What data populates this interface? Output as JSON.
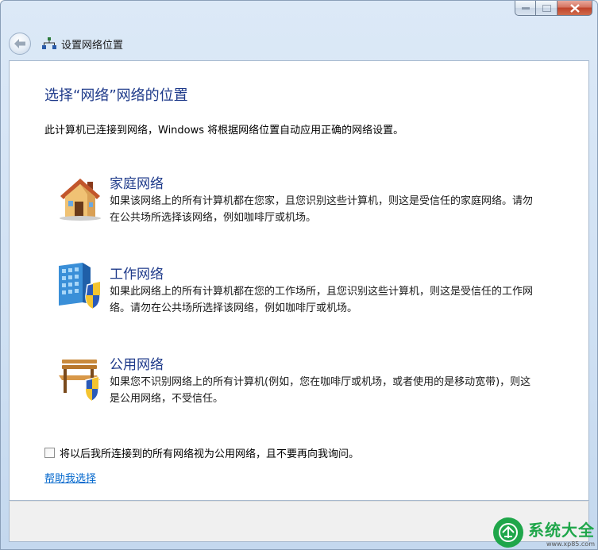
{
  "window": {
    "title": "设置网络位置"
  },
  "page": {
    "heading": "选择“网络”网络的位置",
    "intro": "此计算机已连接到网络，Windows 将根据网络位置自动应用正确的网络设置。"
  },
  "options": [
    {
      "title": "家庭网络",
      "icon": "house-icon",
      "description": "如果该网络上的所有计算机都在您家，且您识别这些计算机，则这是受信任的家庭网络。请勿在公共场所选择该网络，例如咖啡厅或机场。"
    },
    {
      "title": "工作网络",
      "icon": "office-building-shield-icon",
      "description": "如果此网络上的所有计算机都在您的工作场所，且您识别这些计算机，则这是受信任的工作网络。请勿在公共场所选择该网络，例如咖啡厅或机场。"
    },
    {
      "title": "公用网络",
      "icon": "park-bench-shield-icon",
      "description": "如果您不识别网络上的所有计算机(例如，您在咖啡厅或机场，或者使用的是移动宽带)，则这是公用网络，不受信任。"
    }
  ],
  "checkbox": {
    "label": "将以后我所连接到的所有网络视为公用网络，且不要再向我询问。",
    "checked": false
  },
  "help_link": "帮助我选择",
  "watermark": {
    "name": "系统大全",
    "url": "www.xp85.com"
  },
  "colors": {
    "heading": "#1e3a8a",
    "link": "#0066cc",
    "watermark": "#1fa64a"
  }
}
